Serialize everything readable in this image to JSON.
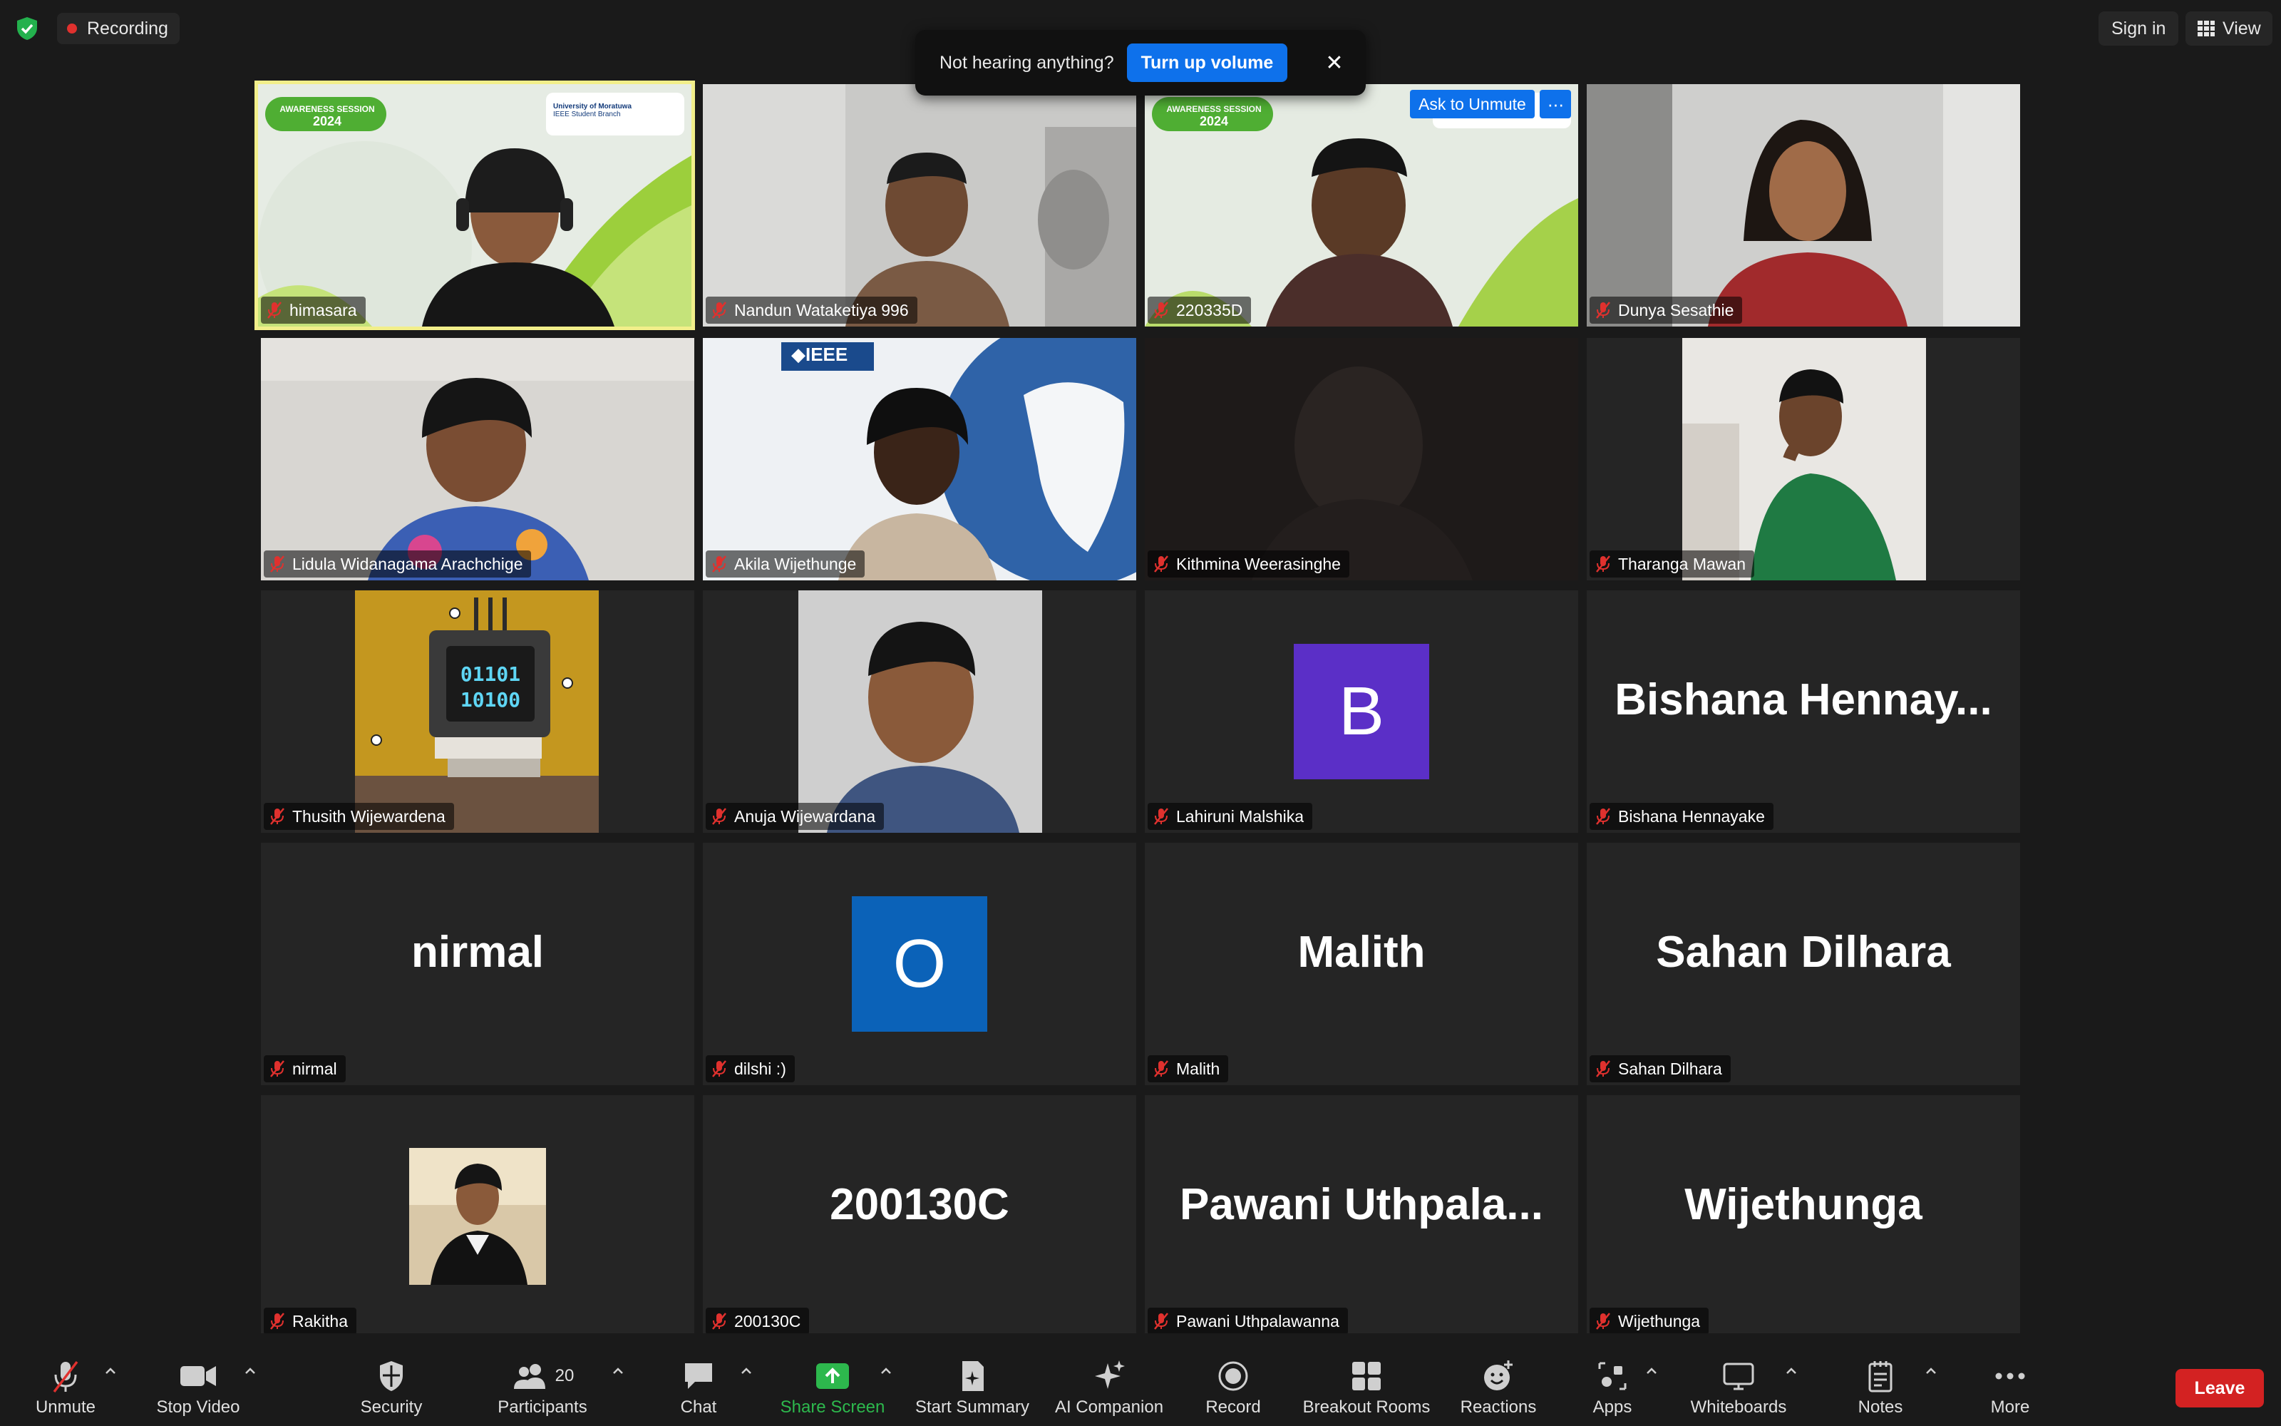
{
  "topbar": {
    "recording_label": "Recording",
    "signin_label": "Sign in",
    "view_label": "View"
  },
  "notification": {
    "message": "Not hearing anything?",
    "action_label": "Turn up volume",
    "close_glyph": "✕"
  },
  "ask_to_unmute": {
    "label": "Ask to Unmute",
    "more_glyph": "···"
  },
  "participants": [
    {
      "name": "himasara",
      "display": "video",
      "banner": "AWARENESS SESSION",
      "banner_year": "2024",
      "org_line1": "University of Moratuwa",
      "org_line2": "IEEE Student Branch"
    },
    {
      "name": "Nandun Wataketiya 996",
      "display": "video"
    },
    {
      "name": "220335D",
      "display": "video",
      "banner": "AWARENESS SESSION",
      "banner_year": "2024"
    },
    {
      "name": "Dunya Sesathie",
      "display": "video"
    },
    {
      "name": "Lidula Widanagama Arachchige",
      "display": "video"
    },
    {
      "name": "Akila Wijethunge",
      "display": "video",
      "logo_text": "◆IEEE"
    },
    {
      "name": "Kithmina Weerasinghe",
      "display": "video"
    },
    {
      "name": "Tharanga Mawan",
      "display": "photo"
    },
    {
      "name": "Thusith Wijewardena",
      "display": "photo",
      "screen_line1": "01101",
      "screen_line2": "10100"
    },
    {
      "name": "Anuja Wijewardana",
      "display": "photo"
    },
    {
      "name": "Lahiruni Malshika",
      "display": "avatar",
      "initial": "B",
      "color": "#5b2fc7"
    },
    {
      "name": "Bishana Hennayake",
      "display": "text",
      "big": "Bishana  Hennay..."
    },
    {
      "name": "nirmal",
      "display": "text",
      "big": "nirmal"
    },
    {
      "name": "dilshi :)",
      "display": "avatar",
      "initial": "O",
      "color": "#0b62b8"
    },
    {
      "name": "Malith",
      "display": "text",
      "big": "Malith"
    },
    {
      "name": "Sahan Dilhara",
      "display": "text",
      "big": "Sahan Dilhara"
    },
    {
      "name": "Rakitha",
      "display": "photo"
    },
    {
      "name": "200130C",
      "display": "text",
      "big": "200130C"
    },
    {
      "name": "Pawani Uthpalawanna",
      "display": "text",
      "big": "Pawani  Uthpala..."
    },
    {
      "name": "Wijethunga",
      "display": "text",
      "big": "Wijethunga"
    }
  ],
  "toolbar": {
    "unmute": "Unmute",
    "stop_video": "Stop Video",
    "security": "Security",
    "participants": "Participants",
    "participants_count": "20",
    "chat": "Chat",
    "share_screen": "Share Screen",
    "start_summary": "Start Summary",
    "ai_companion": "AI Companion",
    "record": "Record",
    "breakout_rooms": "Breakout Rooms",
    "reactions": "Reactions",
    "apps": "Apps",
    "whiteboards": "Whiteboards",
    "notes": "Notes",
    "more": "More",
    "leave": "Leave"
  },
  "colors": {
    "accent_blue": "#0e71eb",
    "share_green": "#2db84d",
    "leave_red": "#d32222",
    "active_speaker": "#f2ef8a",
    "muted_red": "#e0312e"
  }
}
